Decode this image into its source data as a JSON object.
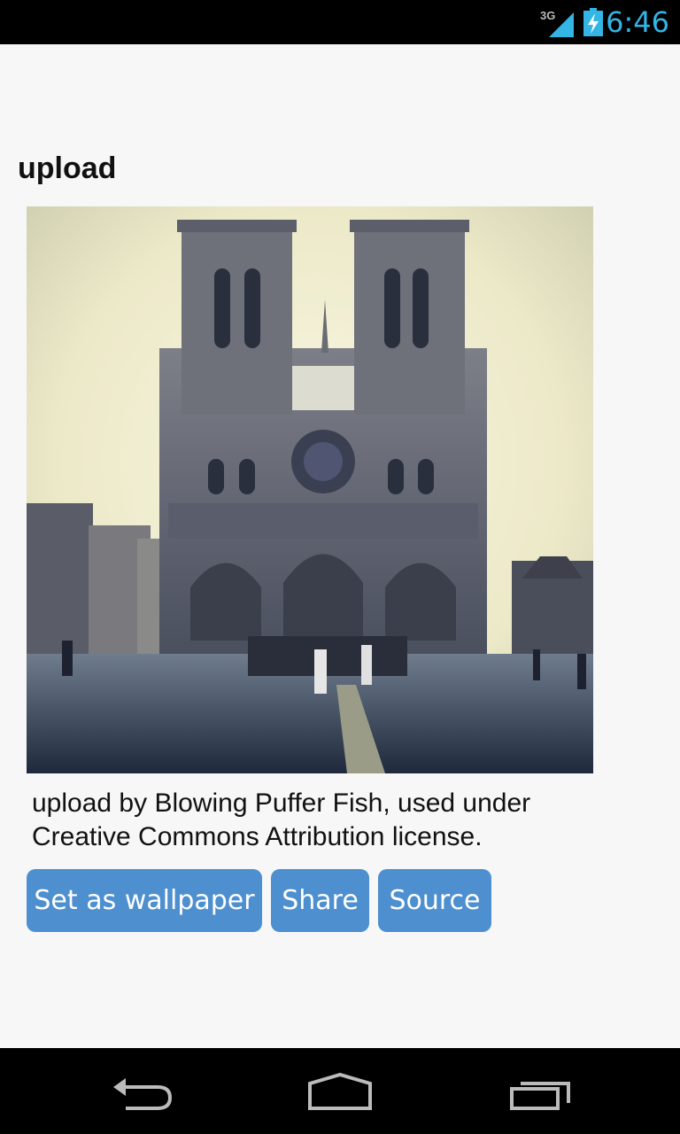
{
  "status_bar": {
    "network": "3G",
    "time": "6:46"
  },
  "page": {
    "title": "upload",
    "image_alt": "Notre-Dame cathedral facade",
    "caption": "upload by Blowing Puffer Fish, used under Creative Commons Attribution license."
  },
  "actions": {
    "wallpaper_label": "Set as wallpaper",
    "share_label": "Share",
    "source_label": "Source"
  },
  "nav": {
    "back_icon": "back-icon",
    "home_icon": "home-icon",
    "recents_icon": "recents-icon"
  },
  "colors": {
    "accent": "#33b5e5",
    "button": "#4d8fcf"
  }
}
